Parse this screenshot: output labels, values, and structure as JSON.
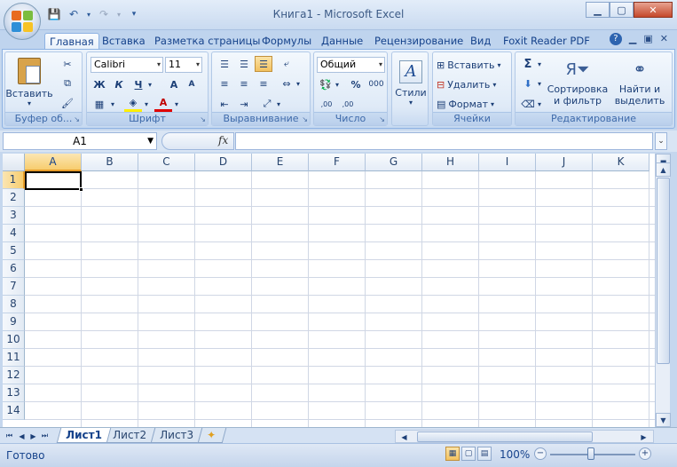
{
  "window": {
    "title": "Книга1 - Microsoft Excel"
  },
  "quick_access": {
    "save_icon": "save-icon",
    "undo_icon": "undo-icon",
    "redo_icon": "redo-icon",
    "customize_icon": "dropdown-icon"
  },
  "ribbon_tabs": [
    "Главная",
    "Вставка",
    "Разметка страницы",
    "Формулы",
    "Данные",
    "Рецензирование",
    "Вид",
    "Foxit Reader PDF"
  ],
  "active_tab": "Главная",
  "groups": {
    "clipboard": {
      "label": "Буфер об...",
      "paste": "Вставить"
    },
    "font": {
      "label": "Шрифт",
      "font_name": "Calibri",
      "font_size": "11",
      "bold": "Ж",
      "italic": "К",
      "underline": "Ч",
      "grow": "A",
      "shrink": "A"
    },
    "alignment": {
      "label": "Выравнивание"
    },
    "number": {
      "label": "Число",
      "format": "Общий",
      "percent": "%",
      "thousands": "000",
      "inc_decimal": ",00",
      "dec_decimal": ",00"
    },
    "styles": {
      "label": "Стили"
    },
    "cells": {
      "label": "Ячейки",
      "insert": "Вставить",
      "delete": "Удалить",
      "format": "Формат"
    },
    "editing": {
      "label": "Редактирование",
      "sum": "Σ",
      "sort_line1": "Сортировка",
      "sort_line2": "и фильтр",
      "find_line1": "Найти и",
      "find_line2": "выделить"
    }
  },
  "formula_bar": {
    "name_box": "A1",
    "fx": "fx",
    "formula": ""
  },
  "columns": [
    "A",
    "B",
    "C",
    "D",
    "E",
    "F",
    "G",
    "H",
    "I",
    "J",
    "K"
  ],
  "rows": [
    "1",
    "2",
    "3",
    "4",
    "5",
    "6",
    "7",
    "8",
    "9",
    "10",
    "11",
    "12",
    "13",
    "14"
  ],
  "selected_cell": {
    "col": "A",
    "row": "1"
  },
  "sheets": [
    "Лист1",
    "Лист2",
    "Лист3"
  ],
  "active_sheet": "Лист1",
  "status": {
    "text": "Готово",
    "zoom": "100%",
    "zoom_minus": "−",
    "zoom_plus": "+"
  }
}
